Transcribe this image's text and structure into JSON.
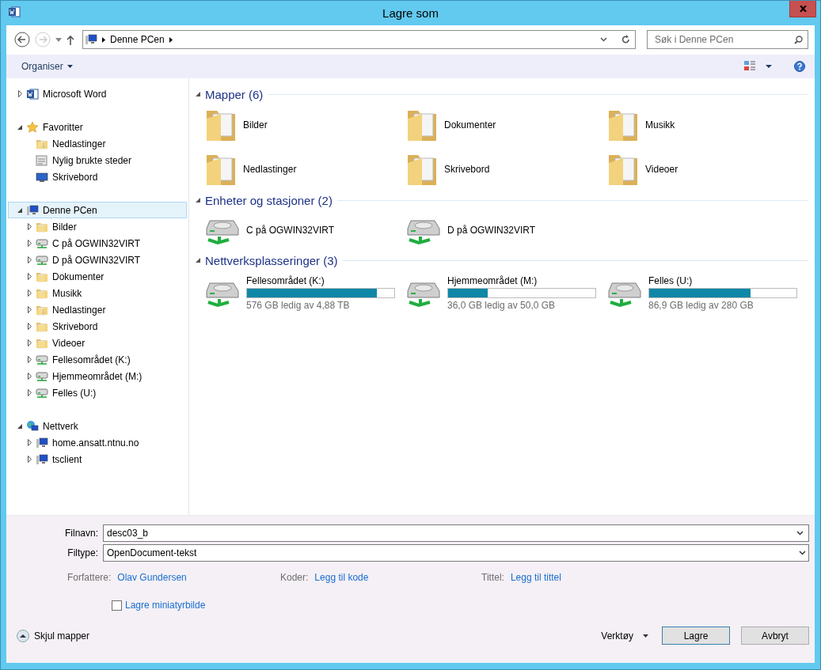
{
  "window": {
    "title": "Lagre som"
  },
  "navigation": {
    "path": [
      "Denne PCen"
    ],
    "search": {
      "placeholder": "Søk i Denne PCen"
    }
  },
  "toolbar": {
    "organize": "Organiser"
  },
  "sidebar": {
    "items": [
      {
        "label": "Microsoft Word",
        "kind": "word",
        "expanded": false,
        "selected": false
      },
      {
        "label": "Favoritter",
        "kind": "star",
        "expanded": true,
        "selected": false,
        "children": [
          {
            "label": "Nedlastinger",
            "kind": "download",
            "selected": false
          },
          {
            "label": "Nylig brukte steder",
            "kind": "recent",
            "selected": false
          },
          {
            "label": "Skrivebord",
            "kind": "desktop",
            "selected": false
          }
        ]
      },
      {
        "label": "Denne PCen",
        "kind": "computer",
        "expanded": true,
        "selected": true,
        "children": [
          {
            "label": "Bilder",
            "kind": "folder",
            "expanded": false,
            "selected": false
          },
          {
            "label": "C på OGWIN32VIRT",
            "kind": "drive",
            "expanded": false,
            "selected": false
          },
          {
            "label": "D på OGWIN32VIRT",
            "kind": "drive",
            "expanded": false,
            "selected": false
          },
          {
            "label": "Dokumenter",
            "kind": "folder",
            "expanded": false,
            "selected": false
          },
          {
            "label": "Musikk",
            "kind": "folder",
            "expanded": false,
            "selected": false
          },
          {
            "label": "Nedlastinger",
            "kind": "download",
            "expanded": false,
            "selected": false
          },
          {
            "label": "Skrivebord",
            "kind": "folder",
            "expanded": false,
            "selected": false
          },
          {
            "label": "Videoer",
            "kind": "folder",
            "expanded": false,
            "selected": false
          },
          {
            "label": "Fellesområdet (K:)",
            "kind": "drive",
            "expanded": false,
            "selected": false
          },
          {
            "label": "Hjemmeområdet (M:)",
            "kind": "drive",
            "expanded": false,
            "selected": false
          },
          {
            "label": "Felles (U:)",
            "kind": "drive",
            "expanded": false,
            "selected": false
          }
        ]
      },
      {
        "label": "Nettverk",
        "kind": "network",
        "expanded": true,
        "selected": false,
        "children": [
          {
            "label": "home.ansatt.ntnu.no",
            "kind": "computer",
            "expanded": false,
            "selected": false
          },
          {
            "label": "tsclient",
            "kind": "computer",
            "expanded": false,
            "selected": false
          }
        ]
      }
    ]
  },
  "groups": [
    {
      "title": "Mapper (6)",
      "items": [
        {
          "kind": "folder",
          "label": "Bilder"
        },
        {
          "kind": "folder",
          "label": "Dokumenter"
        },
        {
          "kind": "folder",
          "label": "Musikk"
        },
        {
          "kind": "folder",
          "label": "Nedlastinger"
        },
        {
          "kind": "folder",
          "label": "Skrivebord"
        },
        {
          "kind": "folder",
          "label": "Videoer"
        }
      ]
    },
    {
      "title": "Enheter og stasjoner (2)",
      "items": [
        {
          "kind": "drive",
          "label": "C på OGWIN32VIRT"
        },
        {
          "kind": "drive",
          "label": "D på OGWIN32VIRT"
        }
      ]
    },
    {
      "title": "Nettverksplasseringer (3)",
      "items": [
        {
          "kind": "netdrive",
          "label": "Fellesområdet (K:)",
          "level": 0.88,
          "free": "576 GB ledig av 4,88 TB"
        },
        {
          "kind": "netdrive",
          "label": "Hjemmeområdet (M:)",
          "level": 0.27,
          "free": "36,0 GB ledig av 50,0 GB"
        },
        {
          "kind": "netdrive",
          "label": "Felles (U:)",
          "level": 0.69,
          "free": "86,9 GB ledig av 280 GB"
        }
      ]
    }
  ],
  "form": {
    "filename": {
      "label": "Filnavn:",
      "value": "desc03_b"
    },
    "filetype": {
      "label": "Filtype:",
      "value": "OpenDocument-tekst"
    },
    "meta": [
      {
        "label": "Forfattere:",
        "value": "Olav Gundersen"
      },
      {
        "label": "Koder:",
        "value": "Legg til kode"
      },
      {
        "label": "Tittel:",
        "value": "Legg til tittel"
      }
    ],
    "thumbnail": {
      "label": "Lagre miniatyrbilde",
      "checked": false
    }
  },
  "footer": {
    "hide_folders": "Skjul mapper",
    "tools": "Verktøy",
    "buttons": [
      {
        "label": "Lagre",
        "kind": "primary"
      },
      {
        "label": "Avbryt",
        "kind": "secondary"
      }
    ]
  }
}
